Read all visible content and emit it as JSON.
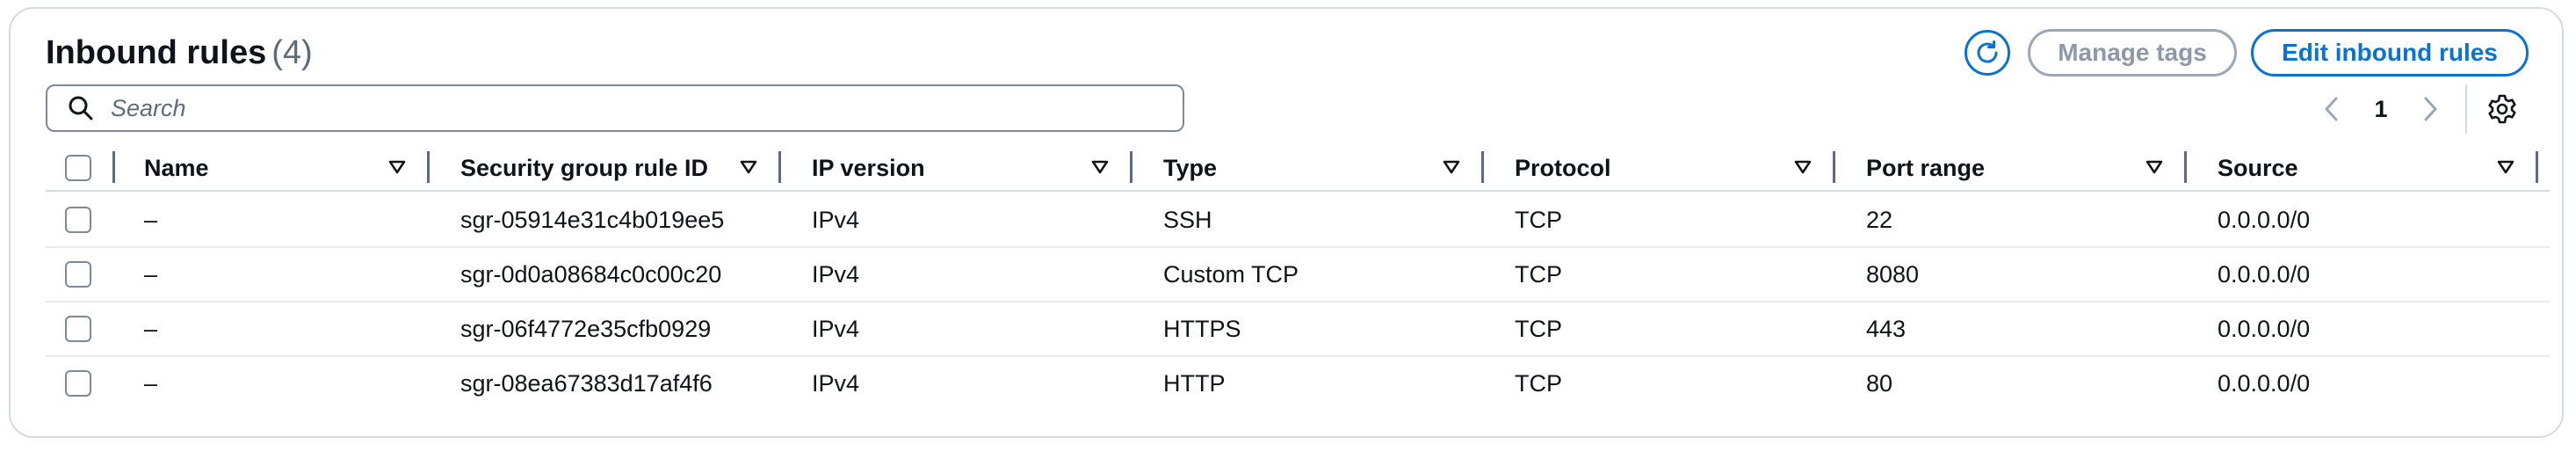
{
  "header": {
    "title": "Inbound rules",
    "count": "(4)"
  },
  "actions": {
    "refresh_icon": "refresh-icon",
    "manage_tags_label": "Manage tags",
    "edit_rules_label": "Edit inbound rules"
  },
  "search": {
    "placeholder": "Search",
    "value": ""
  },
  "pagination": {
    "current_page": "1"
  },
  "table": {
    "columns": [
      {
        "label": "Name"
      },
      {
        "label": "Security group rule ID"
      },
      {
        "label": "IP version"
      },
      {
        "label": "Type"
      },
      {
        "label": "Protocol"
      },
      {
        "label": "Port range"
      },
      {
        "label": "Source"
      }
    ],
    "rows": [
      {
        "name": "–",
        "rule_id": "sgr-05914e31c4b019ee5",
        "ip_version": "IPv4",
        "type": "SSH",
        "protocol": "TCP",
        "port_range": "22",
        "source": "0.0.0.0/0"
      },
      {
        "name": "–",
        "rule_id": "sgr-0d0a08684c0c00c20",
        "ip_version": "IPv4",
        "type": "Custom TCP",
        "protocol": "TCP",
        "port_range": "8080",
        "source": "0.0.0.0/0"
      },
      {
        "name": "–",
        "rule_id": "sgr-06f4772e35cfb0929",
        "ip_version": "IPv4",
        "type": "HTTPS",
        "protocol": "TCP",
        "port_range": "443",
        "source": "0.0.0.0/0"
      },
      {
        "name": "–",
        "rule_id": "sgr-08ea67383d17af4f6",
        "ip_version": "IPv4",
        "type": "HTTP",
        "protocol": "TCP",
        "port_range": "80",
        "source": "0.0.0.0/0"
      }
    ]
  },
  "colors": {
    "accent": "#0972d3",
    "disabled": "#9ba7b6",
    "text": "#0f141a",
    "muted": "#5f6b7a",
    "border": "#d5dbdb"
  }
}
